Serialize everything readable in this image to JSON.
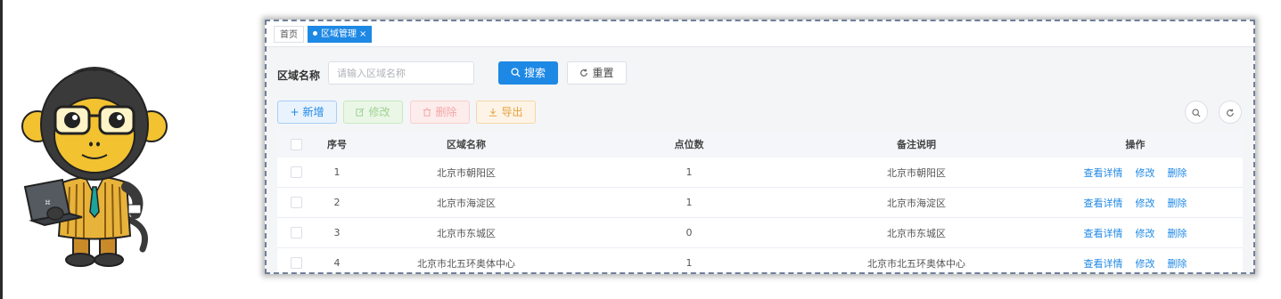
{
  "tabs": {
    "home": "首页",
    "active": "区域管理",
    "close": "×"
  },
  "search": {
    "label": "区域名称",
    "placeholder": "请输入区域名称",
    "search_btn": "搜索",
    "reset_btn": "重置"
  },
  "toolbar": {
    "add": "新增",
    "edit": "修改",
    "delete": "删除",
    "export": "导出"
  },
  "table": {
    "headers": [
      "序号",
      "区域名称",
      "点位数",
      "备注说明",
      "操作"
    ],
    "rows": [
      {
        "index": "1",
        "name": "北京市朝阳区",
        "points": "1",
        "note": "北京市朝阳区"
      },
      {
        "index": "2",
        "name": "北京市海淀区",
        "points": "1",
        "note": "北京市海淀区"
      },
      {
        "index": "3",
        "name": "北京市东城区",
        "points": "0",
        "note": "北京市东城区"
      },
      {
        "index": "4",
        "name": "北京市北五环奥体中心",
        "points": "1",
        "note": "北京市北五环奥体中心"
      }
    ],
    "actions": {
      "view": "查看详情",
      "edit": "修改",
      "delete": "删除"
    }
  },
  "icons": {
    "search": "search-icon",
    "refresh": "refresh-icon",
    "plus": "plus-icon",
    "edit": "edit-icon",
    "trash": "trash-icon",
    "download": "download-icon"
  },
  "colors": {
    "primary": "#1e88e5",
    "success": "#9fd393",
    "danger": "#f2a6a6",
    "warning": "#e6a23c"
  }
}
